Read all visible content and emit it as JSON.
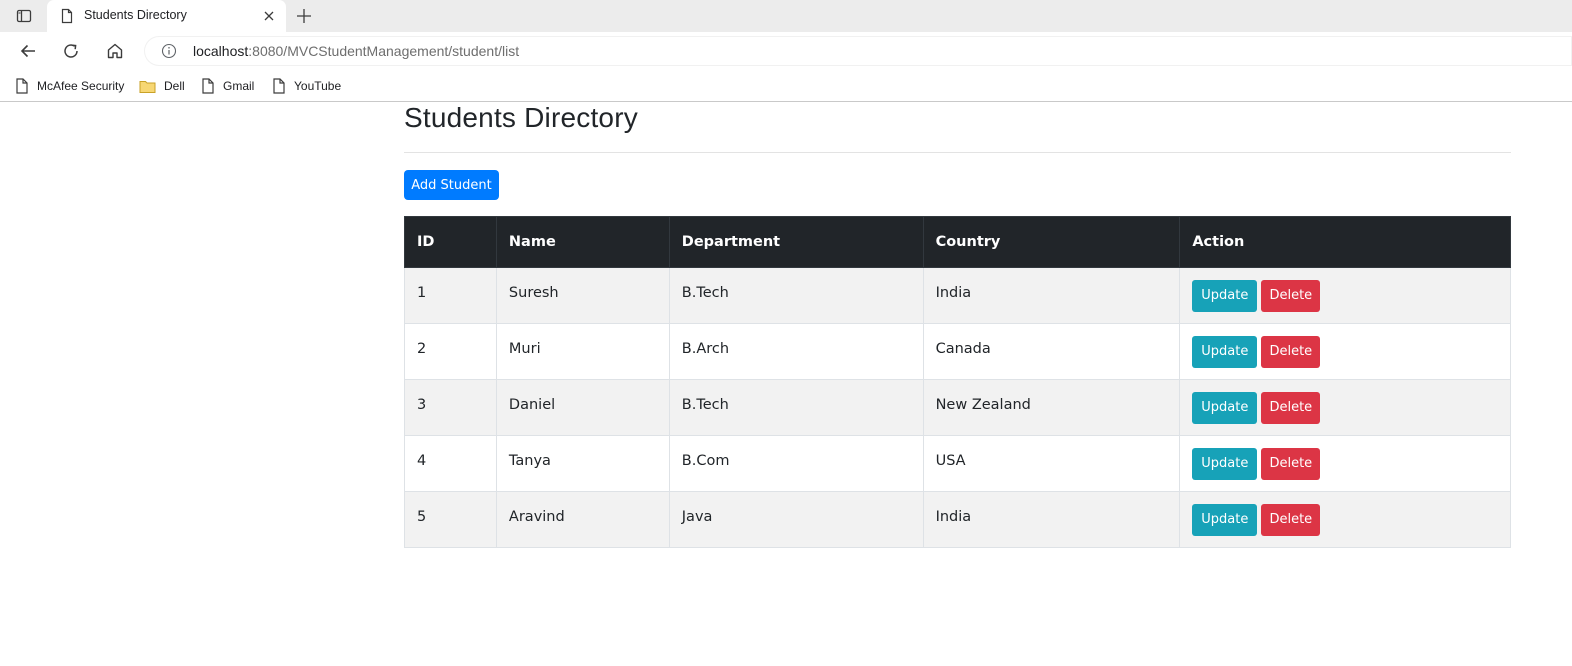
{
  "browser": {
    "tab_title": "Students Directory",
    "url_host": "localhost",
    "url_rest": ":8080/MVCStudentManagement/student/list",
    "icons": [
      "sidebar-toggle-icon",
      "page-icon",
      "close-icon",
      "plus-icon",
      "back-arrow-icon",
      "reload-icon",
      "home-icon",
      "info-icon"
    ],
    "bookmarks": [
      {
        "label": "McAfee Security",
        "icon": "page-icon"
      },
      {
        "label": "Dell",
        "icon": "folder-icon"
      },
      {
        "label": "Gmail",
        "icon": "page-icon"
      },
      {
        "label": "YouTube",
        "icon": "page-icon"
      }
    ]
  },
  "page": {
    "title": "Students Directory",
    "add_button": "Add Student",
    "colors": {
      "primary": "#007bff",
      "info": "#17a2b8",
      "danger": "#dc3545",
      "header_dark": "#212529"
    }
  },
  "table": {
    "headers": [
      "ID",
      "Name",
      "Department",
      "Country",
      "Action"
    ],
    "rows": [
      {
        "id": "1",
        "name": "Suresh",
        "department": "B.Tech",
        "country": "India"
      },
      {
        "id": "2",
        "name": "Muri",
        "department": "B.Arch",
        "country": "Canada"
      },
      {
        "id": "3",
        "name": "Daniel",
        "department": "B.Tech",
        "country": "New Zealand"
      },
      {
        "id": "4",
        "name": "Tanya",
        "department": "B.Com",
        "country": "USA"
      },
      {
        "id": "5",
        "name": "Aravind",
        "department": "Java",
        "country": "India"
      }
    ],
    "update_label": "Update",
    "delete_label": "Delete"
  }
}
